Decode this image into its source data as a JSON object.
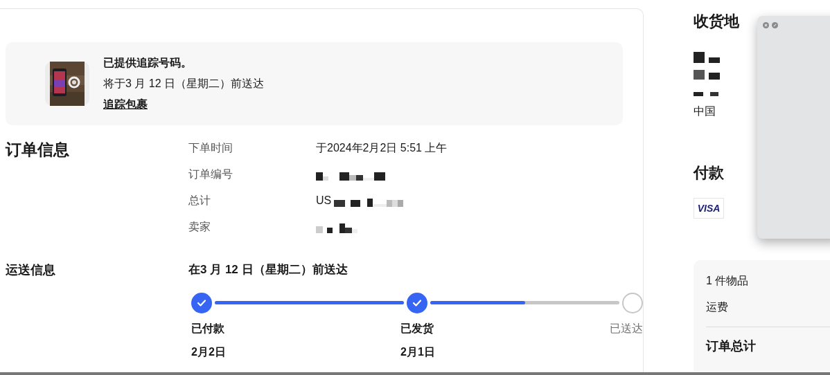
{
  "banner": {
    "title": "已提供追踪号码。",
    "subtitle": "将于3 月 12 日（星期二）前送达",
    "link": "追踪包裹"
  },
  "order_info": {
    "heading": "订单信息",
    "rows": [
      {
        "label": "下单时间",
        "value": "于2024年2月2日 5:51 上午"
      },
      {
        "label": "订单编号"
      },
      {
        "label": "总计",
        "value": "US"
      },
      {
        "label": "卖家"
      }
    ]
  },
  "shipping": {
    "heading": "运送信息",
    "eta": "在3 月 12 日（星期二）前送达",
    "steps": [
      {
        "label": "已付款",
        "date": "2月2日",
        "done": true
      },
      {
        "label": "已发货",
        "date": "2月1日",
        "done": true
      },
      {
        "label": "已送达",
        "done": false
      }
    ],
    "segments": [
      {
        "level": 1
      },
      {
        "level": 0.5
      }
    ]
  },
  "address": {
    "heading": "收货地",
    "country": "中国"
  },
  "payment": {
    "heading": "付款",
    "card": "VISA"
  },
  "summary": {
    "rows": [
      "1 件物品",
      "运费"
    ],
    "total": "订单总计"
  },
  "overlay_window": {
    "buttons": [
      {
        "kind": "close"
      },
      {
        "kind": "minimize"
      }
    ]
  }
}
